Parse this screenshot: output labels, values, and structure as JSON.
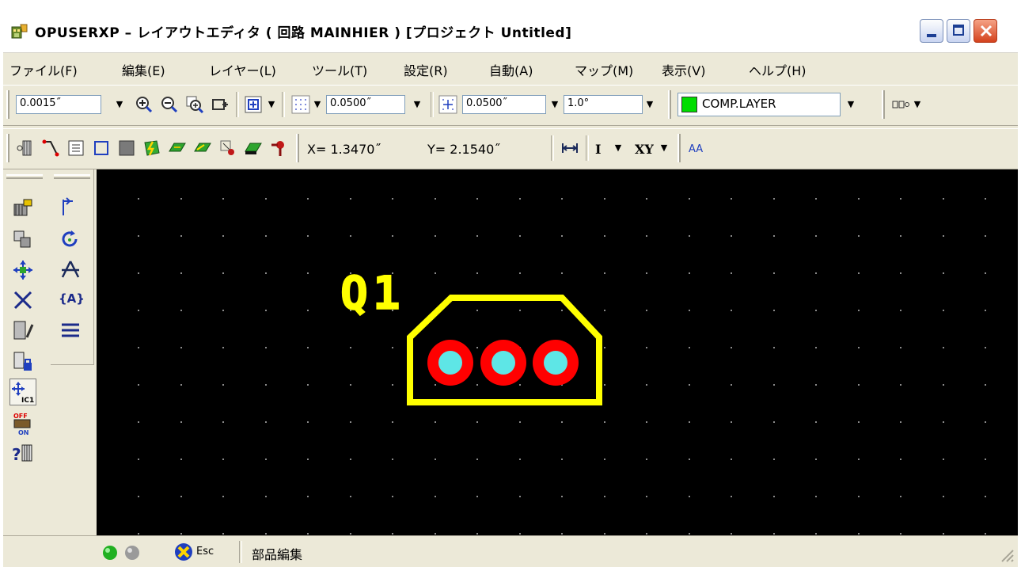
{
  "window": {
    "title": "OPUSERXP – レイアウトエディタ ( 回路 MAINHIER ) [プロジェクト Untitled]",
    "controls": {
      "minimize": "minimize-icon",
      "maximize": "maximize-icon",
      "close": "close-icon"
    }
  },
  "menubar": {
    "items": [
      {
        "label": "ファイル(F)"
      },
      {
        "label": "編集(E)"
      },
      {
        "label": "レイヤー(L)"
      },
      {
        "label": "ツール(T)"
      },
      {
        "label": "設定(R)"
      },
      {
        "label": "自動(A)"
      },
      {
        "label": "マップ(M)"
      },
      {
        "label": "表示(V)"
      },
      {
        "label": "ヘルプ(H)"
      }
    ]
  },
  "toolbar1": {
    "step_value": "0.0015˝",
    "grid_value": "0.0500˝",
    "snap_value": "0.0500˝",
    "angle_value": "1.0°",
    "layer_value": "COMP.LAYER",
    "layer_color": "#00dd00"
  },
  "toolbar2": {
    "x_readout": "X= 1.3470˝",
    "y_readout": "Y= 2.1540˝",
    "text_tool": "I",
    "xy_tool": "XY",
    "font_tool": "AA"
  },
  "canvas": {
    "background": "#000000",
    "grid_dot_color": "#8a8a8a",
    "component": {
      "designator": "Q1",
      "outline_color": "#ffff00",
      "pad_color": "#ff0000",
      "hole_color": "#5ee6e6"
    }
  },
  "statusbar": {
    "esc_label": "Esc",
    "mode_text": "部品編集"
  }
}
